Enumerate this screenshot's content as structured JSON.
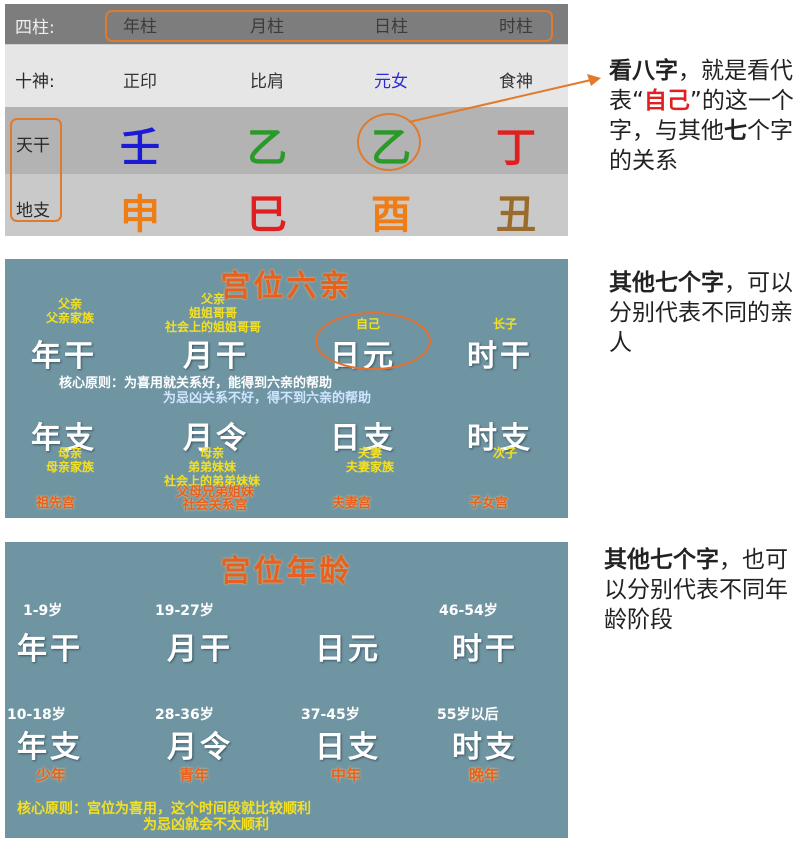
{
  "table": {
    "header": {
      "label": "四柱:",
      "cols": [
        "年柱",
        "月柱",
        "日柱",
        "时柱"
      ]
    },
    "ten_gods": {
      "label": "十神:",
      "cols": [
        "正印",
        "比肩",
        "元女",
        "食神"
      ]
    },
    "stems": {
      "label": "天干",
      "cols": [
        "壬",
        "乙",
        "乙",
        "丁"
      ]
    },
    "branches": {
      "label": "地支",
      "cols": [
        "申",
        "巳",
        "酉",
        "丑"
      ]
    },
    "colors": {
      "stems": [
        "#1b1bd6",
        "#2a9a2a",
        "#2a9a2a",
        "#e02020"
      ],
      "branches": [
        "#ef7d16",
        "#e02020",
        "#ef7d16",
        "#9a6b2a"
      ],
      "ten_highlight": "#2c2cd6",
      "annotation": "#e07a2c"
    }
  },
  "side1": {
    "p1": "看八字",
    "p2": "，就是看代表“",
    "p3": "自己",
    "p4": "”的这一个字，与其他",
    "p5": "七",
    "p6": "个字的关系"
  },
  "panel2": {
    "title": "宫位六亲",
    "stems": [
      "年干",
      "月干",
      "日元",
      "时干"
    ],
    "branches": [
      "年支",
      "月令",
      "日支",
      "时支"
    ],
    "top_nian": [
      "父亲",
      "父亲家族"
    ],
    "top_yue": [
      "父亲",
      "姐姐哥哥",
      "社会上的姐姐哥哥"
    ],
    "top_ri": "自己",
    "top_shi": "长子",
    "rule1": "核心原则：为喜用就关系好，能得到六亲的帮助",
    "rule2": "为忌凶关系不好，得不到六亲的帮助",
    "bot_nian": [
      "母亲",
      "母亲家族"
    ],
    "bot_yue": [
      "母亲",
      "弟弟妹妹",
      "社会上的弟弟妹妹"
    ],
    "bot_ri": [
      "夫妻",
      "夫妻家族"
    ],
    "bot_shi": "次子",
    "palaces": [
      "祖先宫",
      "父母兄弟姐妹",
      "社会关系宫",
      "夫妻宫",
      "子女宫"
    ]
  },
  "side2": {
    "p1": "其他七个字",
    "p2": "，可以分别代表不同的亲人"
  },
  "panel3": {
    "title": "宫位年龄",
    "ages_top": [
      "1-9岁",
      "19-27岁",
      "46-54岁"
    ],
    "stems": [
      "年干",
      "月干",
      "日元",
      "时干"
    ],
    "ages_bot": [
      "10-18岁",
      "28-36岁",
      "37-45岁",
      "55岁以后"
    ],
    "branches": [
      "年支",
      "月令",
      "日支",
      "时支"
    ],
    "stages": [
      "少年",
      "青年",
      "中年",
      "晚年"
    ],
    "rule1": "核心原则：宫位为喜用，这个时间段就比较顺利",
    "rule2": "为忌凶就会不太顺利"
  },
  "side3": {
    "p1": "其他七个字",
    "p2": "，也可以分别代表不同年龄阶段"
  }
}
